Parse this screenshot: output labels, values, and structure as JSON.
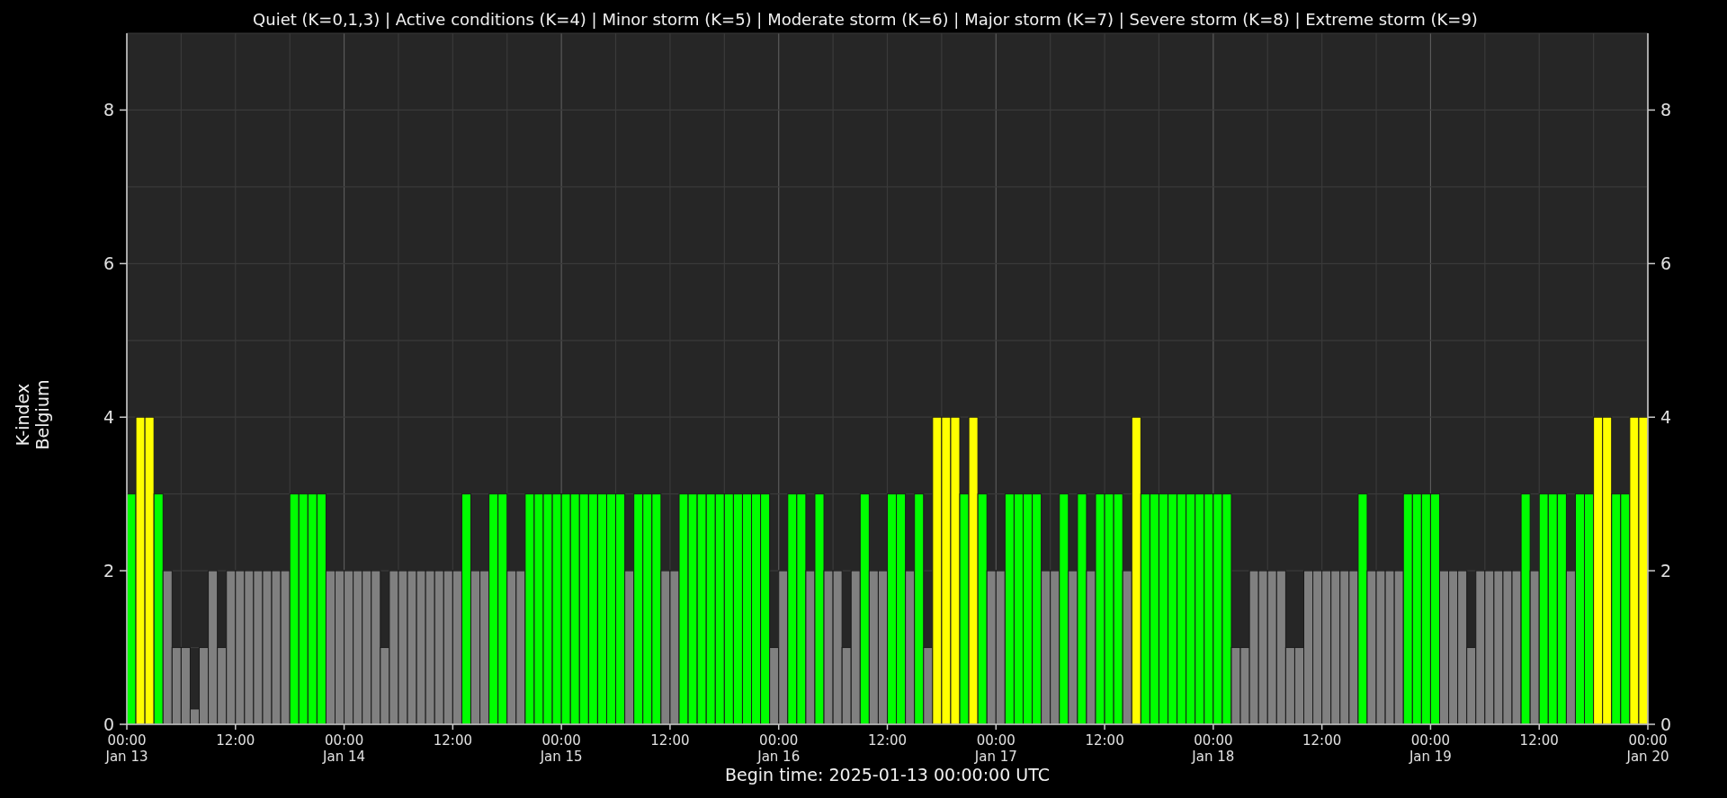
{
  "chart": {
    "chart_data": {
      "type": "bar",
      "title": "Quiet (K=0,1,3) | Active conditions (K=4) | Minor storm (K=5) | Moderate storm (K=6) | Major storm (K=7) | Severe storm (K=8) | Extreme storm (K=9)",
      "xlabel": "Begin time: 2025-01-13 00:00:00 UTC",
      "ylabel": "K-index\nBelgium",
      "ylim": [
        0,
        9
      ],
      "grid": true,
      "categories": [
        "00:00\nJan 13",
        null,
        null,
        null,
        null,
        null,
        null,
        null,
        null,
        null,
        null,
        null,
        "12:00",
        null,
        null,
        null,
        null,
        null,
        null,
        null,
        null,
        null,
        null,
        null,
        "00:00\nJan 14",
        null,
        null,
        null,
        null,
        null,
        null,
        null,
        null,
        null,
        null,
        null,
        "12:00",
        null,
        null,
        null,
        null,
        null,
        null,
        null,
        null,
        null,
        null,
        null,
        "00:00\nJan 15",
        null,
        null,
        null,
        null,
        null,
        null,
        null,
        null,
        null,
        null,
        null,
        "12:00",
        null,
        null,
        null,
        null,
        null,
        null,
        null,
        null,
        null,
        null,
        null,
        "00:00\nJan 16",
        null,
        null,
        null,
        null,
        null,
        null,
        null,
        null,
        null,
        null,
        null,
        "12:00",
        null,
        null,
        null,
        null,
        null,
        null,
        null,
        null,
        null,
        null,
        null,
        "00:00\nJan 17",
        null,
        null,
        null,
        null,
        null,
        null,
        null,
        null,
        null,
        null,
        null,
        "12:00",
        null,
        null,
        null,
        null,
        null,
        null,
        null,
        null,
        null,
        null,
        null,
        "00:00\nJan 18",
        null,
        null,
        null,
        null,
        null,
        null,
        null,
        null,
        null,
        null,
        null,
        "12:00",
        null,
        null,
        null,
        null,
        null,
        null,
        null,
        null,
        null,
        null,
        null,
        "00:00\nJan 19",
        null,
        null,
        null,
        null,
        null,
        null,
        null,
        null,
        null,
        null,
        null,
        "12:00",
        null,
        null,
        null,
        null,
        null,
        null,
        null,
        null,
        null,
        null,
        null,
        "00:00\nJan 20"
      ],
      "yticks": [
        0,
        2,
        4,
        6,
        8
      ],
      "series": [
        {
          "values": [
            3,
            4,
            4,
            3,
            2,
            1,
            1,
            0.2,
            1,
            2,
            1,
            2,
            2,
            2,
            2,
            2,
            2,
            2,
            3,
            3,
            3,
            3,
            2,
            2,
            2,
            2,
            2,
            2,
            1,
            2,
            2,
            2,
            2,
            2,
            2,
            2,
            2,
            3,
            2,
            2,
            3,
            3,
            2,
            2,
            3,
            3,
            3,
            3,
            3,
            3,
            3,
            3,
            3,
            3,
            3,
            2,
            3,
            3,
            3,
            2,
            2,
            3,
            3,
            3,
            3,
            3,
            3,
            3,
            3,
            3,
            3,
            1,
            2,
            3,
            3,
            2,
            3,
            2,
            2,
            1,
            2,
            3,
            2,
            2,
            3,
            3,
            2,
            3,
            1,
            4,
            4,
            4,
            3,
            4,
            3,
            2,
            2,
            3,
            3,
            3,
            3,
            2,
            2,
            3,
            2,
            3,
            2,
            3,
            3,
            3,
            2,
            4,
            3,
            3,
            3,
            3,
            3,
            3,
            3,
            3,
            3,
            3,
            1,
            1,
            2,
            2,
            2,
            2,
            1,
            1,
            2,
            2,
            2,
            2,
            2,
            2,
            3,
            2,
            2,
            2,
            2,
            3,
            3,
            3,
            3,
            2,
            2,
            2,
            1,
            2,
            2,
            2,
            2,
            2,
            3,
            2,
            3,
            3,
            3,
            2,
            3,
            3,
            4,
            4,
            3,
            3,
            4,
            4,
            null
          ]
        }
      ]
    },
    "right_axis": {
      "tick_labels": [
        "8",
        "6",
        "4",
        "2",
        "0"
      ]
    }
  }
}
